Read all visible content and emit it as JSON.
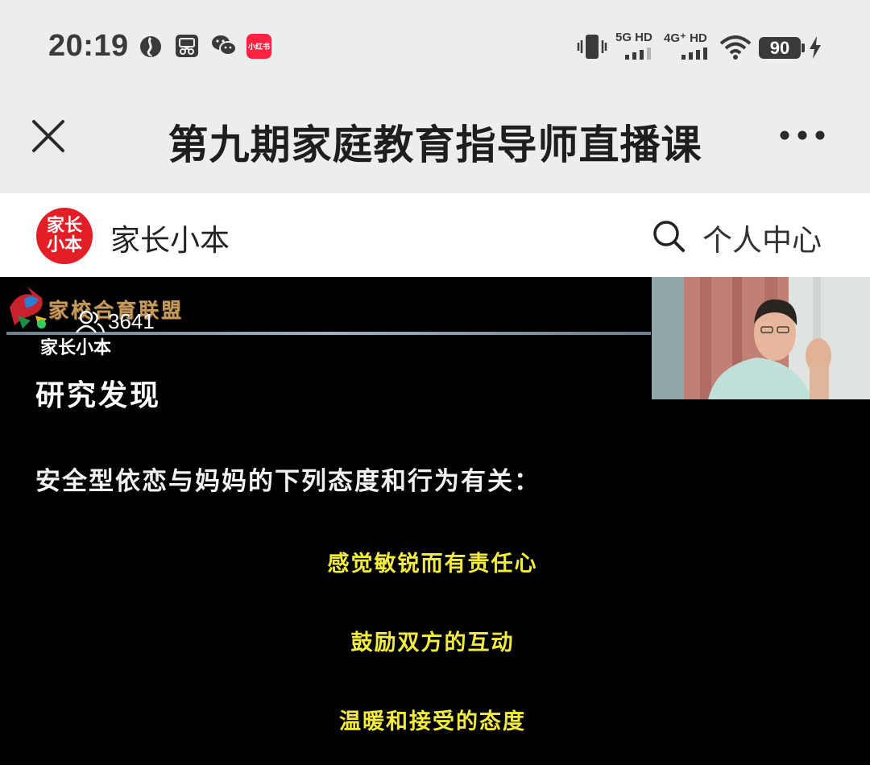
{
  "status_bar": {
    "time": "20:19",
    "xhs_app_label": "小红书",
    "net1": "5G HD",
    "net2": "4G⁺ HD",
    "battery": "90"
  },
  "title_bar": {
    "title": "第九期家庭教育指导师直播课"
  },
  "brand": {
    "logo_line1": "家长",
    "logo_line2": "小本",
    "name": "家长小本",
    "personal_center": "个人中心"
  },
  "video": {
    "alliance_title": "家校合育联盟",
    "viewer_count": "3641",
    "watermark": "家长小本",
    "slide": {
      "heading": "研究发现",
      "intro": "安全型依恋与妈妈的下列态度和行为有关：",
      "points": [
        "感觉敏锐而有责任心",
        "鼓励双方的互动",
        "温暖和接受的态度"
      ]
    }
  },
  "colors": {
    "status_bg": "#ededed",
    "brand_red": "#e31e26",
    "slide_highlight": "#f3ec3a",
    "live_green": "#2fd15c"
  },
  "icons": {
    "status_left": [
      "browser-icon",
      "screenshot-icon",
      "wechat-icon",
      "xiaohongshu-icon"
    ],
    "status_right": [
      "vibrate-icon",
      "signal-icon",
      "wifi-icon",
      "battery-icon",
      "charging-icon"
    ],
    "title_bar": [
      "close-icon",
      "more-icon"
    ],
    "brand_bar": [
      "search-icon"
    ],
    "video": [
      "viewers-icon",
      "alliance-logo-icon"
    ]
  }
}
